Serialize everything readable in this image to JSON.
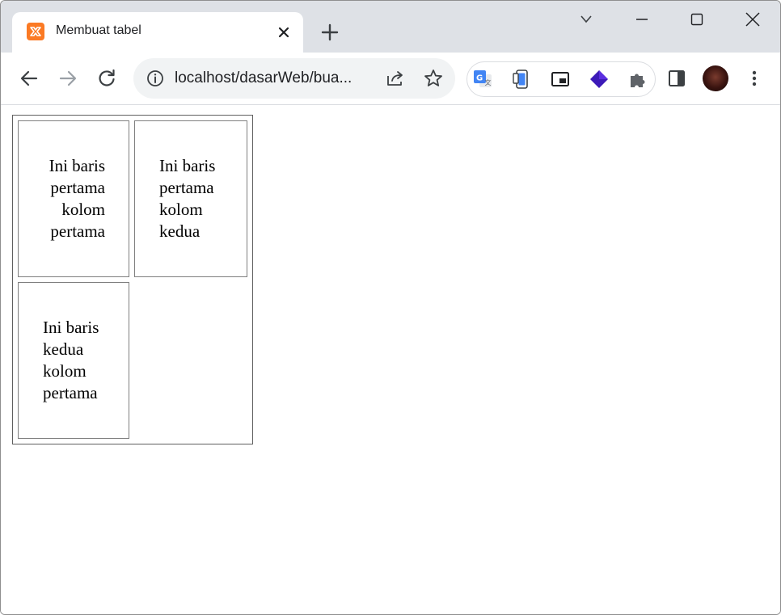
{
  "browser": {
    "tab": {
      "title": "Membuat tabel",
      "favicon": "xampp-icon"
    },
    "new_tab_icon": "plus-icon",
    "window_controls": [
      "tab-search-icon",
      "minimize-icon",
      "maximize-icon",
      "close-icon"
    ],
    "toolbar": {
      "back_icon": "arrow-left-icon",
      "forward_icon": "arrow-right-icon",
      "reload_icon": "reload-icon",
      "address": "localhost/dasarWeb/bua...",
      "site_info_icon": "info-icon",
      "share_icon": "share-icon",
      "bookmark_icon": "star-icon",
      "extensions": [
        "google-translate-icon",
        "device-icon",
        "picture-in-picture-icon",
        "layers-icon",
        "puzzle-icon"
      ],
      "side_panel_icon": "side-panel-icon",
      "profile": "avatar",
      "menu_icon": "kebab-menu-icon"
    },
    "accent_colors": {
      "tabstrip": "#dee1e6",
      "omnibox": "#f1f3f4",
      "favicon": "#fb7a24",
      "translate": "#4285f4",
      "layers": "#3c1ab8"
    }
  },
  "page": {
    "table": {
      "rows": [
        {
          "cells": [
            {
              "text": "Ini baris pertama kolom pertama",
              "align": "right"
            },
            {
              "text": "Ini baris pertama kolom kedua",
              "align": "left"
            }
          ]
        },
        {
          "cells": [
            {
              "text": "Ini baris kedua kolom pertama",
              "align": "left"
            }
          ]
        }
      ]
    }
  }
}
